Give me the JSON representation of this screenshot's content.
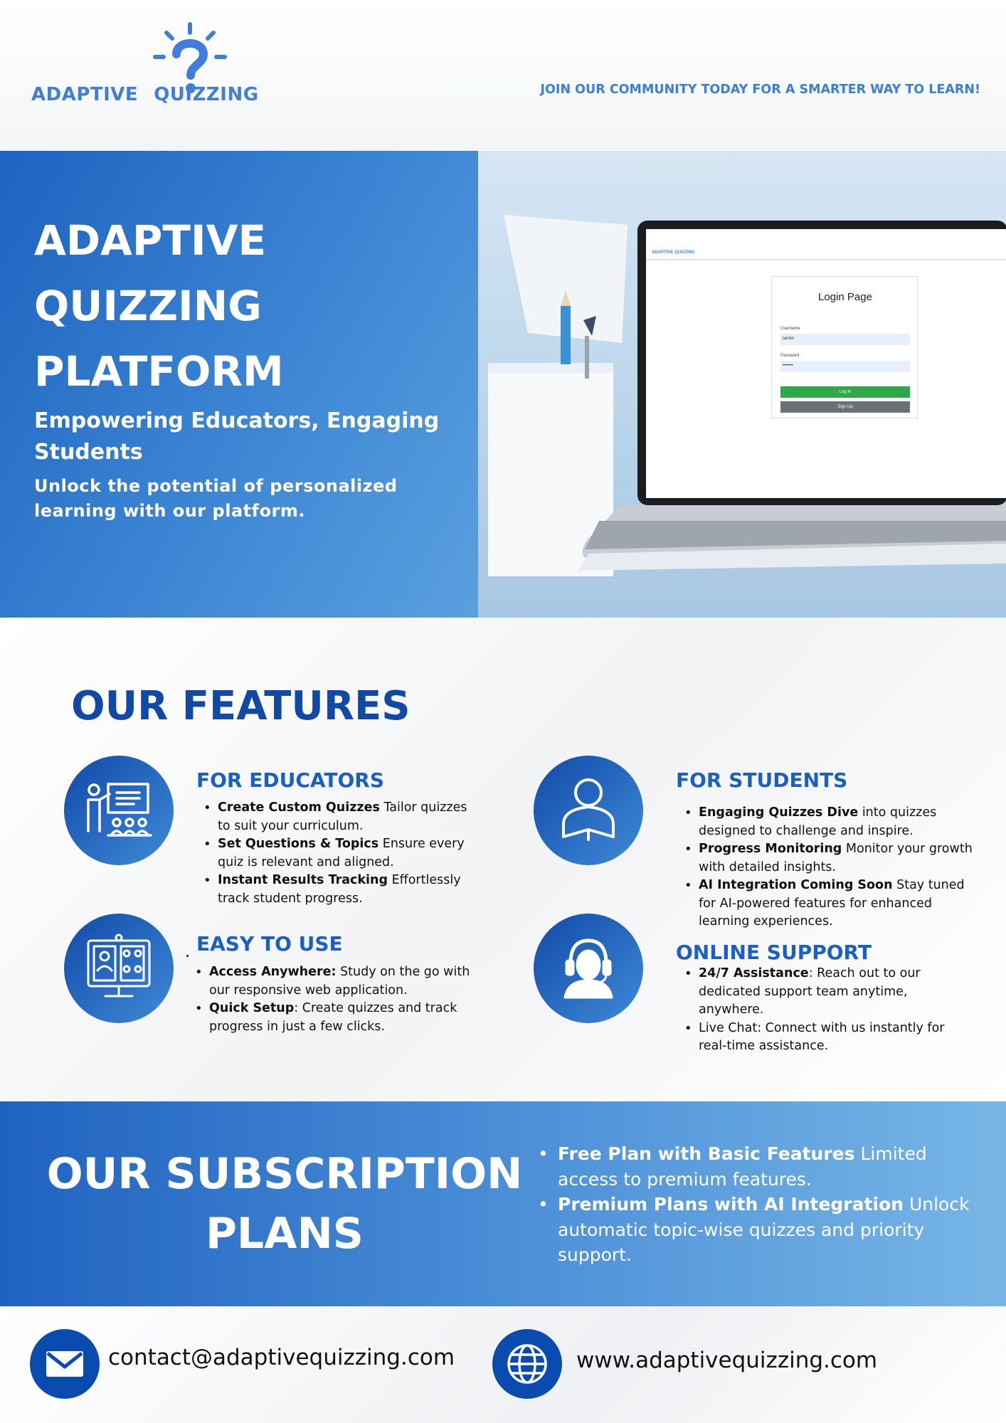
{
  "brand": {
    "name_left": "ADAPTIVE",
    "name_right": "QUIZZING",
    "icon": "lightbulb-question-icon",
    "color": "#3f7fd9"
  },
  "header": {
    "tagline": "JOIN OUR COMMUNITY TODAY FOR A SMARTER WAY TO LEARN!"
  },
  "hero": {
    "title_lines": [
      "ADAPTIVE",
      "QUIZZING",
      "PLATFORM"
    ],
    "subtitle": "Empowering Educators, Engaging Students",
    "description": "Unlock the potential of personalized learning with our platform.",
    "gradient": [
      "#1e63c0",
      "#5aa0df"
    ]
  },
  "laptop_screen": {
    "app_logo": "ADAPTIVE QUIZZING",
    "login_title": "Login Page",
    "username_label": "Username",
    "username_value": "tamim",
    "password_label": "Password",
    "password_value": "•••••••",
    "login_button": "Log In",
    "signup_button": "Sign Up"
  },
  "features": {
    "title": "OUR FEATURES",
    "educators": {
      "heading": "FOR EDUCATORS",
      "icon": "teacher-presentation-icon",
      "items": [
        {
          "bold": "Create Custom Quizzes",
          "text": " Tailor quizzes to suit your curriculum."
        },
        {
          "bold": "Set Questions & Topics",
          "text": " Ensure every quiz is relevant and aligned."
        },
        {
          "bold": "Instant Results Tracking",
          "text": " Effortlessly track student progress."
        }
      ]
    },
    "students": {
      "heading": "FOR STUDENTS",
      "icon": "student-reading-icon",
      "items": [
        {
          "bold": "Engaging Quizzes Dive",
          "text": " into quizzes designed to challenge and inspire."
        },
        {
          "bold": "Progress Monitoring",
          "text": " Monitor your growth with detailed insights."
        },
        {
          "bold": "AI Integration Coming Soon",
          "text": " Stay tuned for AI-powered features for enhanced learning experiences."
        }
      ]
    },
    "easy": {
      "heading": "EASY TO USE",
      "icon": "video-conference-monitor-icon",
      "items": [
        {
          "bold": "Access Anywhere:",
          "text": " Study on the go with our responsive web application."
        },
        {
          "bold": "Quick Setup",
          "text": ": Create quizzes and track progress in just a few clicks."
        }
      ]
    },
    "support": {
      "heading": "ONLINE SUPPORT",
      "icon": "headset-support-icon",
      "items": [
        {
          "bold": "24/7 Assistance",
          "text": ": Reach out to our dedicated support team anytime, anywhere."
        },
        {
          "bold": "",
          "text": "Live Chat: Connect with us instantly for real-time assistance."
        }
      ]
    },
    "heading_color": "#1a5fc2",
    "title_color": "#1049a6"
  },
  "subscription": {
    "title_lines": [
      "OUR SUBSCRIPTION",
      "PLANS"
    ],
    "items": [
      {
        "bold": "Free Plan with Basic Features",
        "text": " Limited access to premium features."
      },
      {
        "bold": "Premium Plans with AI Integration",
        "text": " Unlock automatic topic-wise quizzes and priority support."
      }
    ]
  },
  "footer": {
    "email": "contact@adaptivequizzing.com",
    "email_icon": "envelope-icon",
    "website": "www.adaptivequizzing.com",
    "website_icon": "globe-icon",
    "icon_color": "#0a4bb0"
  }
}
